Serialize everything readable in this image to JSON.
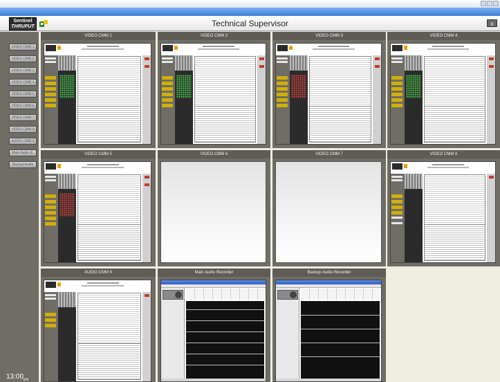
{
  "header": {
    "logo_line1": "Sentinel",
    "logo_line2": "THRUPUT",
    "title": "Technical Supervisor",
    "close_label": "x"
  },
  "sidebar": {
    "buttons": [
      "VIDEO CMM 1",
      "VIDEO CMM 2",
      "VIDEO CMM 3",
      "VIDEO CMM 4",
      "VIDEO CMM 5",
      "VIDEO CMM 6",
      "VIDEO CMM 7",
      "VIDEO CMM 8",
      "AUDIO CMM 9",
      "Main Audio R.",
      "Backup Audio"
    ],
    "clock": "13:00",
    "clock_suffix": "EN"
  },
  "panels": {
    "p1": "VIDEO CMM 1",
    "p2": "VIDEO CMM 2",
    "p3": "VIDEO CMM 3",
    "p4": "VIDEO CMM 4",
    "p5": "VIDEO CMM 5",
    "p6": "VIDEO CMM 6",
    "p7": "VIDEO CMM 7",
    "p8": "VIDEO CMM 8",
    "p9": "AUDIO CMM 9",
    "p10": "Main Audio Recorder",
    "p11": "Backup Audio Recorder"
  },
  "colors": {
    "panel_bg": "#6f6d66",
    "title_bg": "#5e5c56",
    "page_bg": "#efede0",
    "status_yellow": "#d2b000"
  }
}
